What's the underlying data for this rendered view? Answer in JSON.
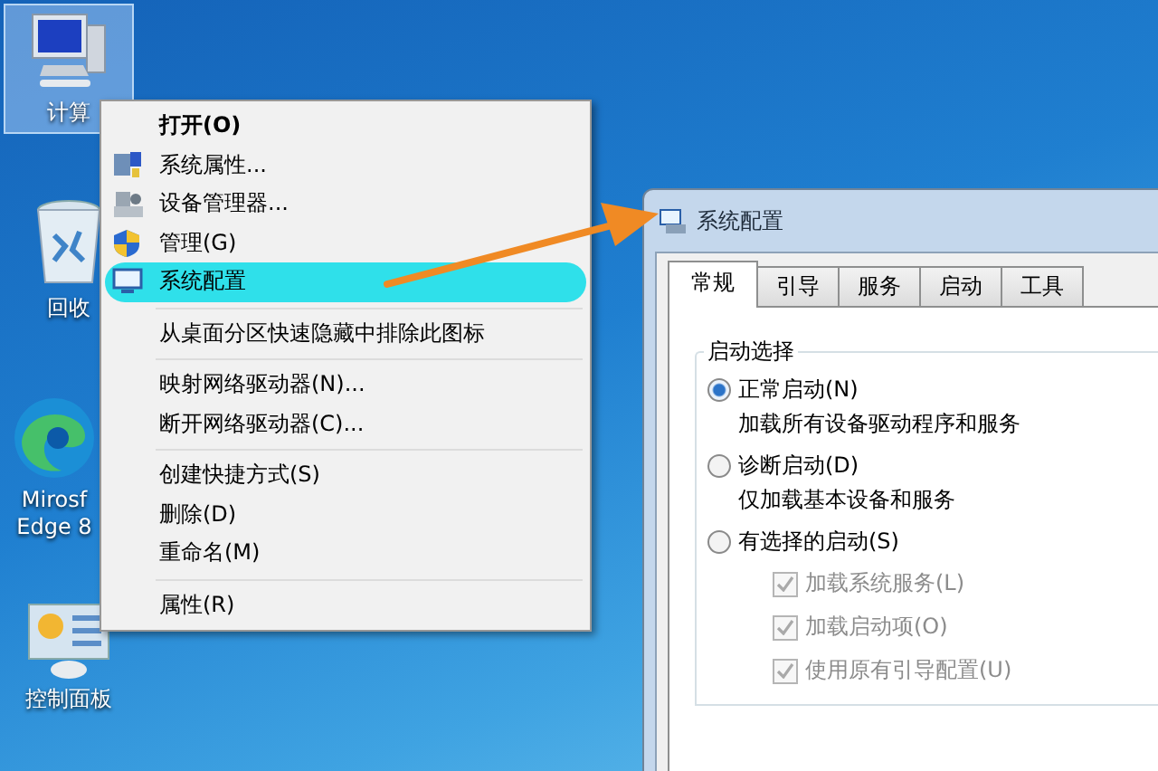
{
  "desktop_icons": [
    {
      "kind": "computer",
      "label": "计算",
      "selected": true
    },
    {
      "kind": "recycle",
      "label": "回收",
      "selected": false
    },
    {
      "kind": "edge",
      "label": "Mirosf\nEdge 8",
      "selected": false
    },
    {
      "kind": "control",
      "label": "控制面板",
      "selected": false
    }
  ],
  "context_menu": {
    "sections": [
      [
        {
          "label": "打开(O)",
          "default": true,
          "highlighted": false
        },
        {
          "label": "系统属性...",
          "default": false,
          "highlighted": false
        },
        {
          "label": "设备管理器...",
          "default": false,
          "highlighted": false
        },
        {
          "label": "管理(G)",
          "default": false,
          "highlighted": false
        },
        {
          "label": "系统配置",
          "default": false,
          "highlighted": true
        }
      ],
      [
        {
          "label": "从桌面分区快速隐藏中排除此图标",
          "default": false,
          "highlighted": false
        }
      ],
      [
        {
          "label": "映射网络驱动器(N)...",
          "default": false,
          "highlighted": false
        },
        {
          "label": "断开网络驱动器(C)...",
          "default": false,
          "highlighted": false
        }
      ],
      [
        {
          "label": "创建快捷方式(S)",
          "default": false,
          "highlighted": false
        },
        {
          "label": "删除(D)",
          "default": false,
          "highlighted": false
        },
        {
          "label": "重命名(M)",
          "default": false,
          "highlighted": false
        }
      ],
      [
        {
          "label": "属性(R)",
          "default": false,
          "highlighted": false
        }
      ]
    ]
  },
  "dialog": {
    "title": "系统配置",
    "tabs": [
      {
        "label": "常规",
        "selected": true
      },
      {
        "label": "引导",
        "selected": false
      },
      {
        "label": "服务",
        "selected": false
      },
      {
        "label": "启动",
        "selected": false
      },
      {
        "label": "工具",
        "selected": false
      }
    ],
    "group": {
      "title": "启动选择",
      "options": [
        {
          "label": "正常启动(N)",
          "description": "加载所有设备驱动程序和服务",
          "selected": true
        },
        {
          "label": "诊断启动(D)",
          "description": "仅加载基本设备和服务",
          "selected": false
        },
        {
          "label": "有选择的启动(S)",
          "selected": false
        }
      ],
      "checkboxes": [
        {
          "label": "加载系统服务(L)",
          "checked": true,
          "disabled": true
        },
        {
          "label": "加载启动项(O)",
          "checked": true,
          "disabled": true
        },
        {
          "label": "使用原有引导配置(U)",
          "checked": true,
          "disabled": true
        }
      ]
    }
  }
}
